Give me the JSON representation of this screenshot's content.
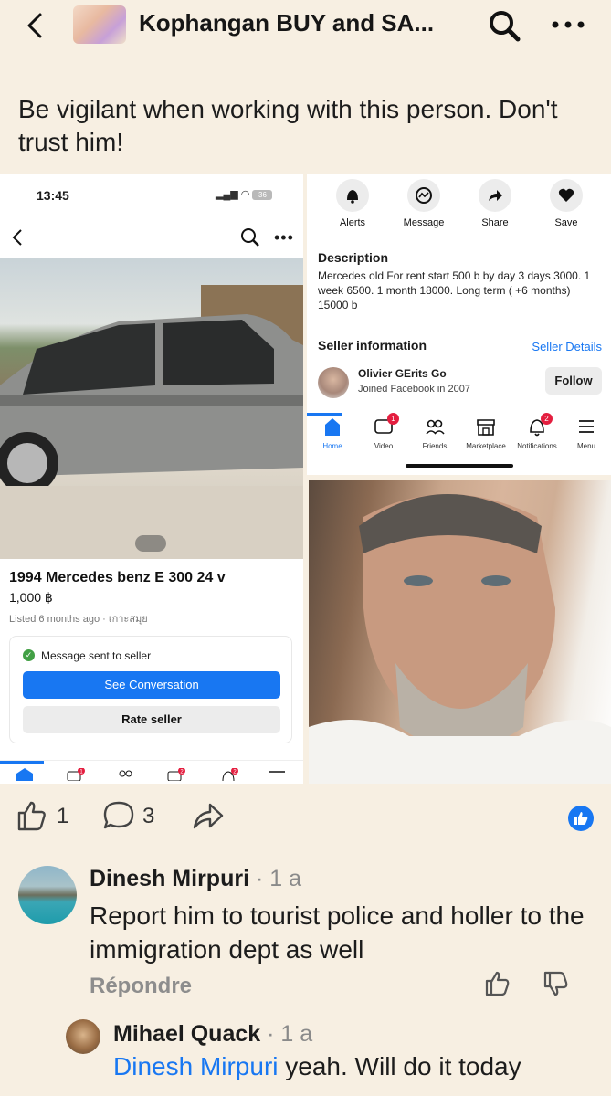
{
  "header": {
    "title": "Kophangan BUY and SA...",
    "back_icon": "chevron-left-icon",
    "search_icon": "search-icon",
    "more_icon": "more-horizontal-icon"
  },
  "post": {
    "text": "Be vigilant when working with this person. Don't trust him!"
  },
  "listing_screenshot": {
    "status_time": "13:45",
    "battery": "36",
    "title": "1994 Mercedes benz E 300 24 v",
    "price": "1,000 ฿",
    "meta": "Listed 6 months ago · เกาะสมุย",
    "message_sent": "Message sent to seller",
    "see_conversation": "See Conversation",
    "rate_seller": "Rate seller",
    "tab_badges": [
      "1",
      "2",
      "2"
    ]
  },
  "details_screenshot": {
    "actions": [
      {
        "label": "Alerts",
        "icon": "bell-icon"
      },
      {
        "label": "Message",
        "icon": "messenger-icon"
      },
      {
        "label": "Share",
        "icon": "share-arrow-icon"
      },
      {
        "label": "Save",
        "icon": "heart-icon"
      }
    ],
    "description_heading": "Description",
    "description_body": "Mercedes old  For rent  start 500 b by day 3 days 3000. 1 week 6500. 1 month 18000.  Long term ( +6 months) 15000 b",
    "seller_heading": "Seller information",
    "seller_details_link": "Seller Details",
    "seller_name": "Olivier GErits Go",
    "seller_joined": "Joined Facebook in 2007",
    "follow": "Follow",
    "tabs": [
      {
        "label": "Home",
        "badge": ""
      },
      {
        "label": "Video",
        "badge": "1"
      },
      {
        "label": "Friends",
        "badge": ""
      },
      {
        "label": "Marketplace",
        "badge": ""
      },
      {
        "label": "Notifications",
        "badge": "2"
      },
      {
        "label": "Menu",
        "badge": ""
      }
    ]
  },
  "reactions": {
    "likes": "1",
    "comments": "3"
  },
  "comments": [
    {
      "name": "Dinesh Mirpuri",
      "time": " · 1 a",
      "text": "Report him to tourist police and holler to the immigration dept as well",
      "reply": "Répondre"
    },
    {
      "name": "Mihael Quack",
      "time": " · 1 a",
      "mention": "Dinesh Mirpuri",
      "text": " yeah. Will do it today"
    }
  ],
  "colors": {
    "background": "#f7efe2",
    "accent": "#1877f2",
    "badge": "#e41e3f"
  }
}
